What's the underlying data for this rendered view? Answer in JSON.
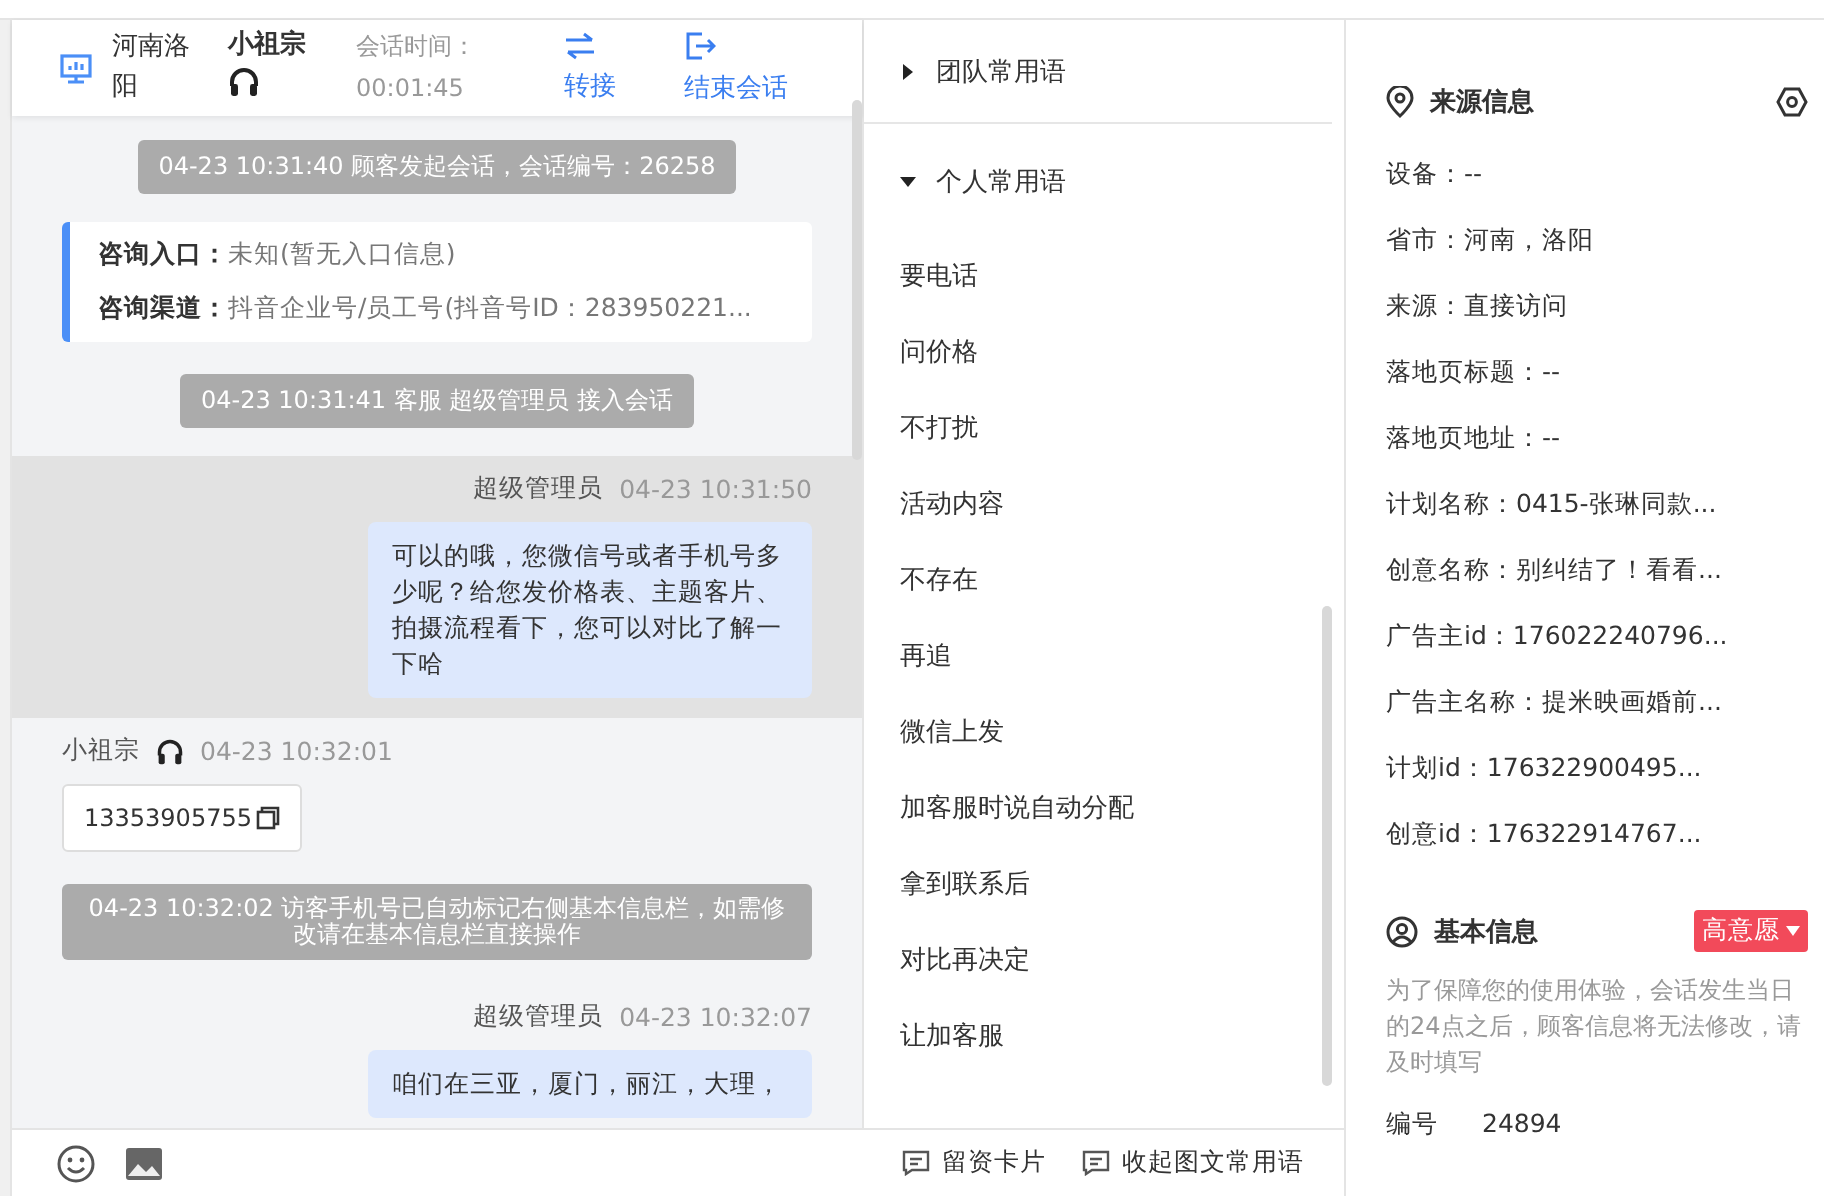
{
  "chat_header": {
    "location": "河南洛阳",
    "visitor": "小祖宗",
    "duration_label": "会话时间：",
    "duration": "00:01:45",
    "actions": [
      {
        "label": "转接",
        "kind": "transfer"
      },
      {
        "label": "结束会话",
        "kind": "end"
      }
    ]
  },
  "messages": [
    {
      "kind": "system",
      "text": "04-23 10:31:40 顾客发起会话，会话编号：26258"
    },
    {
      "kind": "info",
      "rows": [
        {
          "label": "咨询入口：",
          "value": "未知(暂无入口信息)"
        },
        {
          "label": "咨询渠道：",
          "value": "抖音企业号/员工号(抖音号ID：283950221..."
        }
      ]
    },
    {
      "kind": "system",
      "text": "04-23 10:31:41 客服 超级管理员 接入会话"
    },
    {
      "kind": "agent",
      "name": "超级管理员",
      "time": "04-23 10:31:50",
      "text": "可以的哦，您微信号或者手机号多少呢？给您发价格表、主题客片、拍摄流程看下，您可以对比了解一下哈",
      "highlighted": true
    },
    {
      "kind": "visitor",
      "name": "小祖宗",
      "time": "04-23 10:32:01",
      "text": "13353905755",
      "highlighted": false
    },
    {
      "kind": "notice",
      "text": "04-23 10:32:02 访客手机号已自动标记右侧基本信息栏，如需修改请在基本信息栏直接操作"
    },
    {
      "kind": "agent",
      "name": "超级管理员",
      "time": "04-23 10:32:07",
      "text": "咱们在三亚，厦门，丽江，大理，",
      "highlighted": false
    }
  ],
  "phrases": {
    "groups": [
      {
        "label": "团队常用语",
        "expanded": false
      },
      {
        "label": "个人常用语",
        "expanded": true
      }
    ],
    "items": [
      "要电话",
      "问价格",
      "不打扰",
      "活动内容",
      "不存在",
      "再追",
      "微信上发",
      "加客服时说自动分配",
      "拿到联系后",
      "对比再决定",
      "让加客服"
    ]
  },
  "toolbar": {
    "buttons": [
      {
        "label": "留资卡片"
      },
      {
        "label": "收起图文常用语"
      }
    ]
  },
  "source_info": {
    "title": "来源信息",
    "fields": [
      "设备：--",
      "省市：河南，洛阳",
      "来源：直接访问",
      "落地页标题：--",
      "落地页地址：--",
      "计划名称：0415-张琳同款...",
      "创意名称：别纠结了！看看...",
      "广告主id：176022240796...",
      "广告主名称：提米映画婚前...",
      "计划id：176322900495...",
      "创意id：176322914767..."
    ]
  },
  "basic_info": {
    "title": "基本信息",
    "intent": {
      "label": "高意愿",
      "color": "#f24a5a"
    },
    "notice": "为了保障您的使用体验，会话发生当日的24点之后，顾客信息将无法修改，请及时填写",
    "fields": [
      {
        "label": "编号",
        "value": "24894"
      }
    ]
  }
}
